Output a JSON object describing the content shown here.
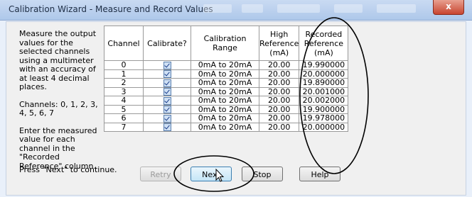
{
  "window": {
    "title": "Calibration Wizard - Measure and Record Values",
    "close_glyph": "x"
  },
  "instructions": {
    "p1": "Measure the output values for the selected channels using a multimeter with an accuracy of at least 4 decimal places.",
    "p2": "Channels: 0, 1, 2, 3, 4, 5, 6, 7",
    "p3": "Enter the measured value for each channel in the \"Recorded Reference\" column.",
    "continue": "Press \"Next\" to continue."
  },
  "table": {
    "headers": {
      "channel": "Channel",
      "calibrate": "Calibrate?",
      "range": "Calibration Range",
      "high_ref": "High Reference (mA)",
      "recorded_ref": "Recorded Reference (mA)"
    },
    "rows": [
      {
        "channel": "0",
        "calibrate": true,
        "range": "0mA to 20mA",
        "high": "20.00",
        "recorded": "19.990000"
      },
      {
        "channel": "1",
        "calibrate": true,
        "range": "0mA to 20mA",
        "high": "20.00",
        "recorded": "20.000000"
      },
      {
        "channel": "2",
        "calibrate": true,
        "range": "0mA to 20mA",
        "high": "20.00",
        "recorded": "19.890000"
      },
      {
        "channel": "3",
        "calibrate": true,
        "range": "0mA to 20mA",
        "high": "20.00",
        "recorded": "20.001000"
      },
      {
        "channel": "4",
        "calibrate": true,
        "range": "0mA to 20mA",
        "high": "20.00",
        "recorded": "20.002000"
      },
      {
        "channel": "5",
        "calibrate": true,
        "range": "0mA to 20mA",
        "high": "20.00",
        "recorded": "19.900000"
      },
      {
        "channel": "6",
        "calibrate": true,
        "range": "0mA to 20mA",
        "high": "20.00",
        "recorded": "19.978000"
      },
      {
        "channel": "7",
        "calibrate": true,
        "range": "0mA to 20mA",
        "high": "20.00",
        "recorded": "20.000000"
      }
    ]
  },
  "buttons": {
    "retry": "Retry",
    "next": "Next",
    "stop": "Stop",
    "help": "Help"
  },
  "colors": {
    "titlebar": "#b9d1ee",
    "close_button": "#c84530",
    "annotation": "#000000"
  }
}
